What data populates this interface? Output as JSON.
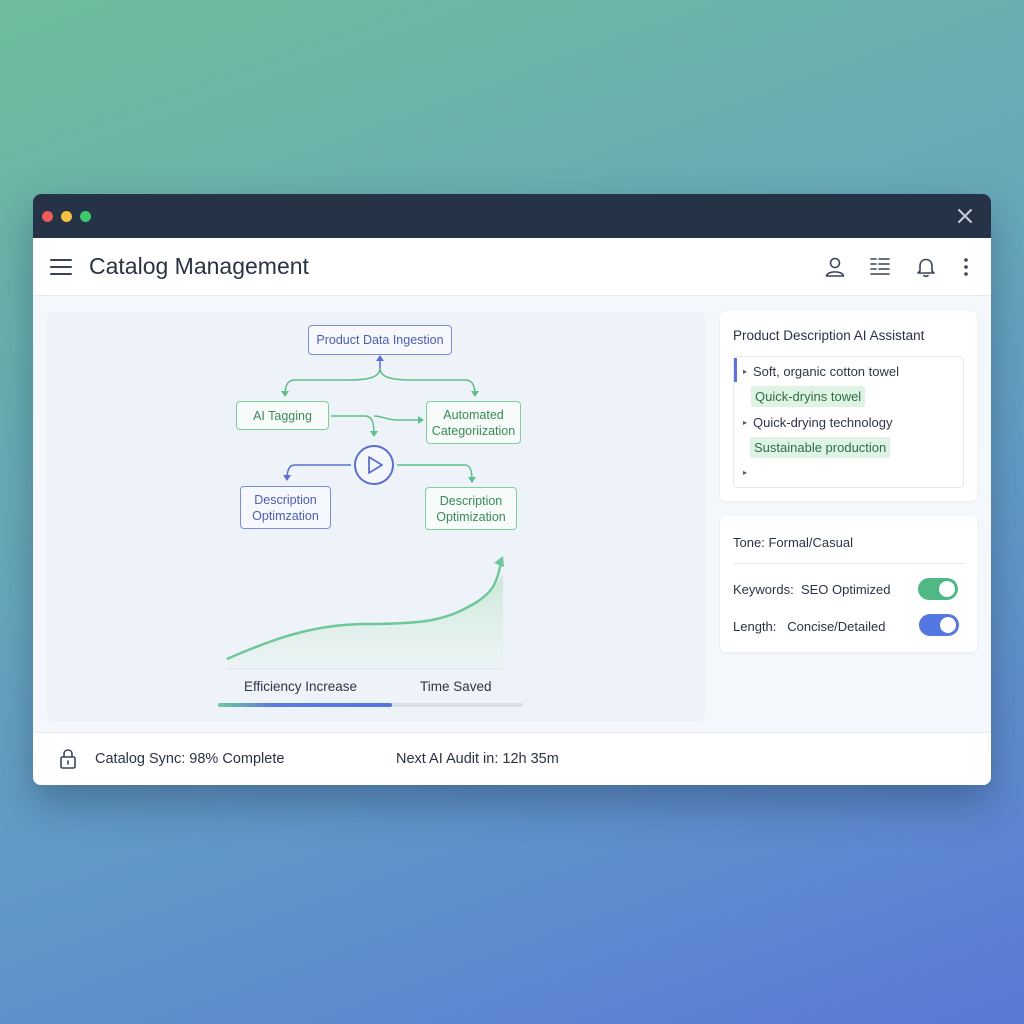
{
  "window": {
    "title_bar_colors": {
      "close": "#ef5b5b",
      "minimize": "#f3c042",
      "maximize": "#3fc86b"
    }
  },
  "appbar": {
    "title": "Catalog Management",
    "icons": [
      "menu-icon",
      "user-icon",
      "list-icon",
      "bell-icon",
      "more-vertical-icon"
    ]
  },
  "workflow": {
    "nodes": {
      "ingestion": "Product Data Ingestion",
      "tagging": "AI Tagging",
      "categorization_line1": "Automated",
      "categorization_line2": "Categoriization",
      "desc_left_line1": "Description",
      "desc_left_line2": "Optimzation",
      "desc_right_line1": "Description",
      "desc_right_line2": "Optimization"
    }
  },
  "chart": {
    "label_left": "Efficiency Increase",
    "label_right": "Time Saved",
    "progress": 0.57,
    "accent": "#6fc89a"
  },
  "assistant": {
    "title": "Product Description AI Assistant",
    "items": [
      {
        "text": "Soft, organic cotton towel",
        "highlight": false
      },
      {
        "text": "Quick-dryins towel",
        "highlight": true
      },
      {
        "text": "Quick-drying technology",
        "highlight": false
      },
      {
        "text": "Sustainable production",
        "highlight": true
      },
      {
        "text": "",
        "highlight": false
      }
    ]
  },
  "settings": {
    "tone_label": "Tone:",
    "tone_value": "Formal/Casual",
    "keywords_label": "Keywords:",
    "keywords_value": "SEO Optimized",
    "keywords_on": true,
    "keywords_color": "#4fb884",
    "length_label": "Length:",
    "length_value": "Concise/Detailed",
    "length_on": true,
    "length_color": "#5577e0"
  },
  "status": {
    "sync": "Catalog Sync: 98% Complete",
    "audit": "Next AI Audit in: 12h 35m"
  }
}
